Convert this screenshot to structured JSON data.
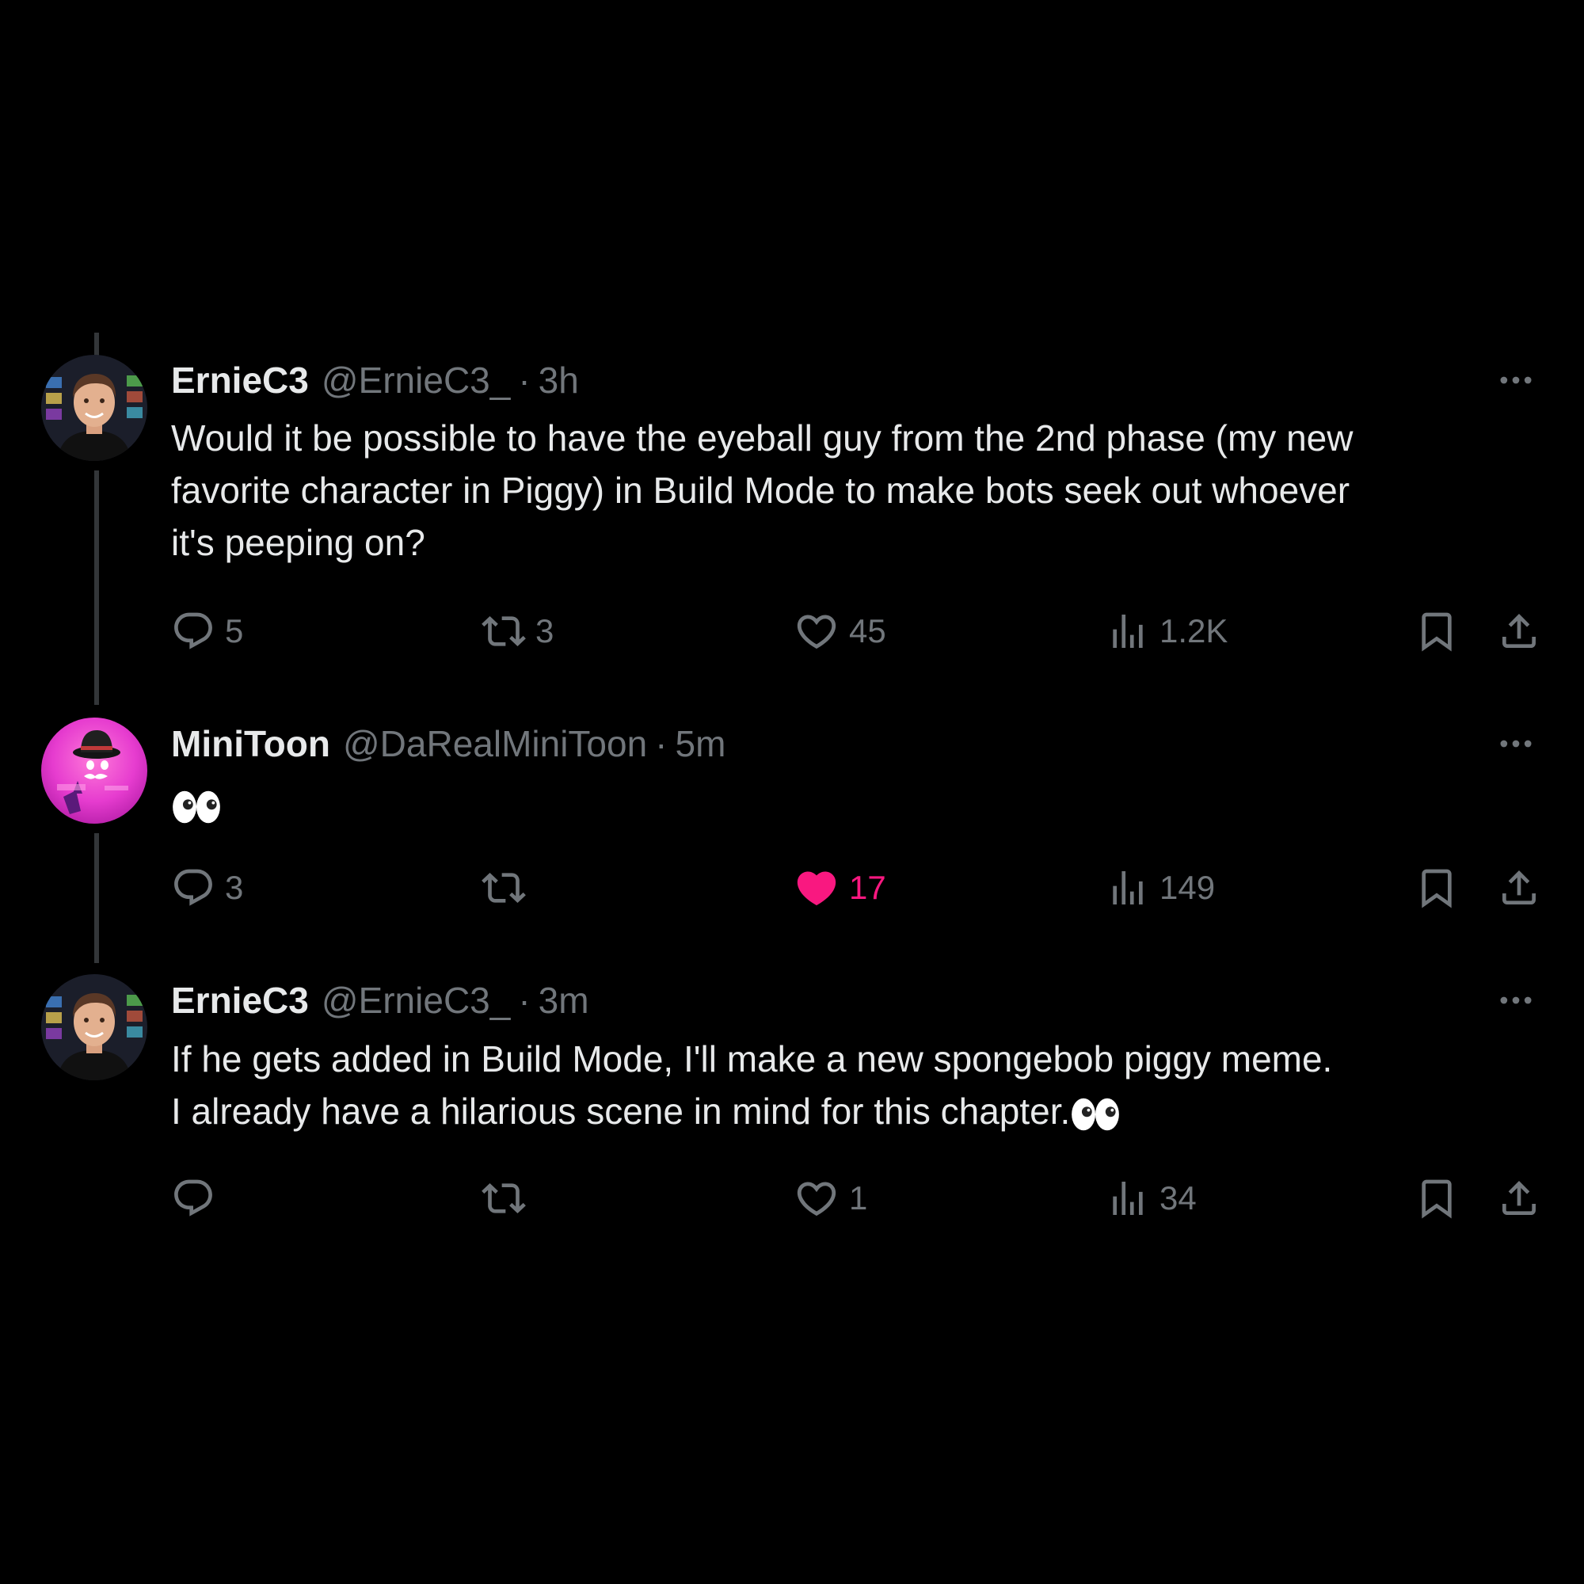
{
  "colors": {
    "background": "#000000",
    "text": "#e7e9ea",
    "muted": "#71767b",
    "like_active": "#f91880",
    "thread_line": "#333639"
  },
  "tweets": [
    {
      "name": "ErnieC3",
      "handle": "@ErnieC3_",
      "separator": "·",
      "time": "3h",
      "avatar": "ernie-avatar",
      "text_lines": [
        "Would it be possible to have the eyeball guy from the 2nd phase (my new",
        "favorite character in Piggy) in Build Mode to make bots seek out whoever",
        "it's peeping on?"
      ],
      "replies": "5",
      "reposts": "3",
      "likes": "45",
      "liked": false,
      "views": "1.2K"
    },
    {
      "name": "MiniToon",
      "handle": "@DaRealMiniToon",
      "separator": "·",
      "time": "5m",
      "avatar": "minitoon-avatar",
      "emoji": "eyes-emoji",
      "replies": "3",
      "reposts": "",
      "likes": "17",
      "liked": true,
      "views": "149"
    },
    {
      "name": "ErnieC3",
      "handle": "@ErnieC3_",
      "separator": "·",
      "time": "3m",
      "avatar": "ernie-avatar",
      "text_lines": [
        "If he gets added in Build Mode, I'll make a new spongebob piggy meme.",
        "I already have a hilarious scene in mind for this chapter."
      ],
      "trailing_emoji": "eyes-emoji",
      "replies": "",
      "reposts": "",
      "likes": "1",
      "liked": false,
      "views": "34"
    }
  ]
}
